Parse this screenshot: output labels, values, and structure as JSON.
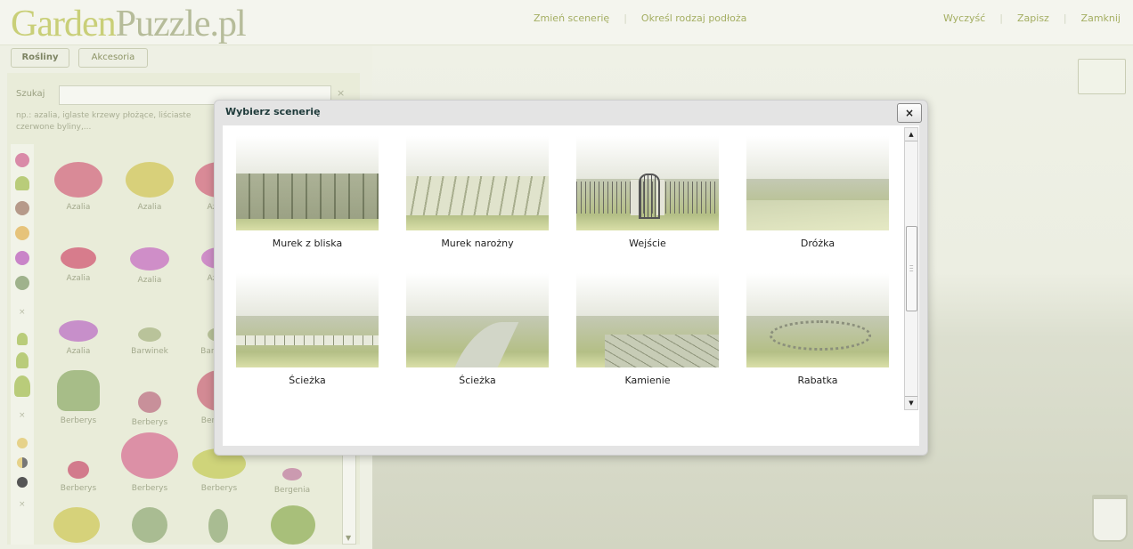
{
  "header": {
    "logo_part1": "Garden",
    "logo_part2": "Puzzle.pl",
    "nav_center": [
      "Zmień scenerię",
      "Określ rodzaj podłoża"
    ],
    "nav_right": [
      "Wyczyść",
      "Zapisz",
      "Zamknij"
    ]
  },
  "tabs": [
    "Rośliny",
    "Akcesoria"
  ],
  "left_panel": {
    "search_label": "Szukaj",
    "search_value": "",
    "search_clear": "×",
    "search_hint": "np.: azalia, iglaste krzewy płożące, liściaste czerwone byliny,...",
    "plants": [
      {
        "label": "Azalia",
        "color": "#d98a97"
      },
      {
        "label": "Azalia",
        "color": "#d8d07a"
      },
      {
        "label": "Azalia",
        "color": "#d98a97"
      },
      {
        "label": "Azalia",
        "color": "#d77c8c"
      },
      {
        "label": "Azalia",
        "color": "#cf8ec8"
      },
      {
        "label": "Azalia",
        "color": "#cf8ec8"
      },
      {
        "label": "Azalia",
        "color": "#c78fca"
      },
      {
        "label": "Barwinek",
        "color": "#b9c39a"
      },
      {
        "label": "Barwinek",
        "color": "#b9c39a"
      },
      {
        "label": "Berberys",
        "color": "#a7bd88"
      },
      {
        "label": "Berberys",
        "color": "#c8909a"
      },
      {
        "label": "Berberys",
        "color": "#d38a94"
      },
      {
        "label": "Berberys",
        "color": "#d27b8c"
      },
      {
        "label": "Berberys",
        "color": "#dc90a6"
      },
      {
        "label": "Berberys",
        "color": "#cfd47a"
      },
      {
        "label": "Bergenia",
        "color": "#cb9ab0"
      }
    ]
  },
  "dialog": {
    "title": "Wybierz scenerię",
    "close_label": "×",
    "scroll_up": "▲",
    "scroll_down": "▼",
    "scenes": [
      {
        "caption": "Murek z bliska",
        "kind": "wall"
      },
      {
        "caption": "Murek narożny",
        "kind": "wall2"
      },
      {
        "caption": "Wejście",
        "kind": "gate"
      },
      {
        "caption": "Dróżka",
        "kind": "path"
      },
      {
        "caption": "Ścieżka",
        "kind": "stones"
      },
      {
        "caption": "Ścieżka",
        "kind": "curve"
      },
      {
        "caption": "Kamienie",
        "kind": "slab"
      },
      {
        "caption": "Rabatka",
        "kind": "ring"
      }
    ]
  },
  "colors": {
    "accent_green": "#a4ae62",
    "logo_green": "#c9cf78",
    "dialog_title": "#1e3a3a"
  }
}
